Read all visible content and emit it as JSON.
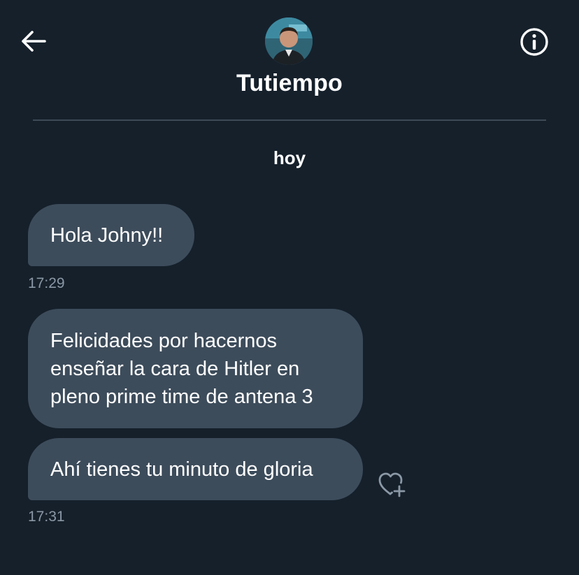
{
  "header": {
    "contact_name": "Tutiempo",
    "back_icon": "arrow-left-icon",
    "info_icon": "info-icon"
  },
  "conversation": {
    "date_separator": "hoy",
    "messages": [
      {
        "text": "Hola Johny!!"
      },
      {
        "lines": [
          "Felicidades por hacernos",
          "enseñar la cara de Hitler en",
          "pleno prime time de antena 3"
        ]
      },
      {
        "text": "Ahí tienes tu minuto de gloria"
      }
    ],
    "timestamps": [
      "17:29",
      "17:31"
    ],
    "reaction_icon": "heart-add-icon"
  },
  "colors": {
    "background": "#15202b",
    "bubble": "#3d4c5b",
    "divider": "#3e4a56",
    "timestamp": "#8b98a5",
    "text": "#ffffff"
  }
}
